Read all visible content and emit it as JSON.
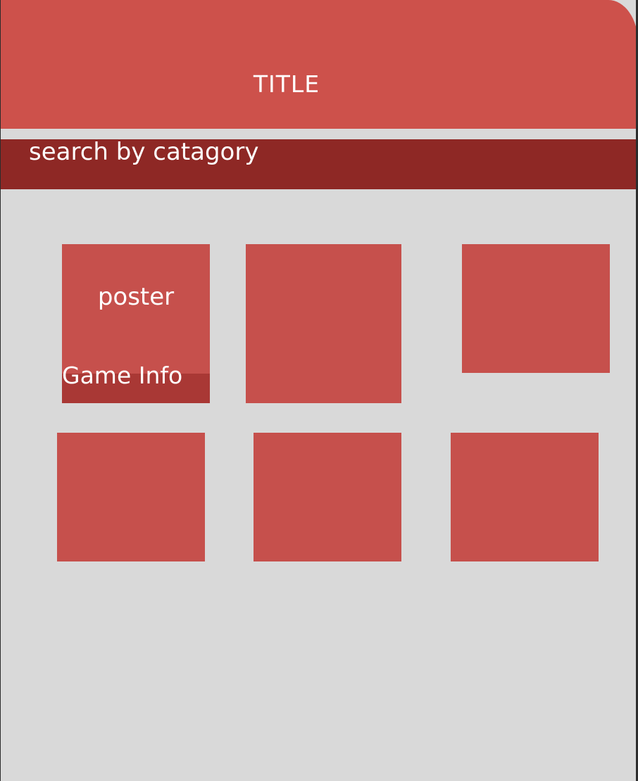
{
  "header": {
    "title": "TITLE"
  },
  "category_search": {
    "label": "search by catagory"
  },
  "cards": [
    {
      "poster_label": "poster",
      "info_label": "Game Info"
    }
  ],
  "colors": {
    "background": "#d9d9d9",
    "title_bar": "#cd514b",
    "category_bar": "#8e2825",
    "card": "#c6504c",
    "info_bar": "#a93835"
  }
}
